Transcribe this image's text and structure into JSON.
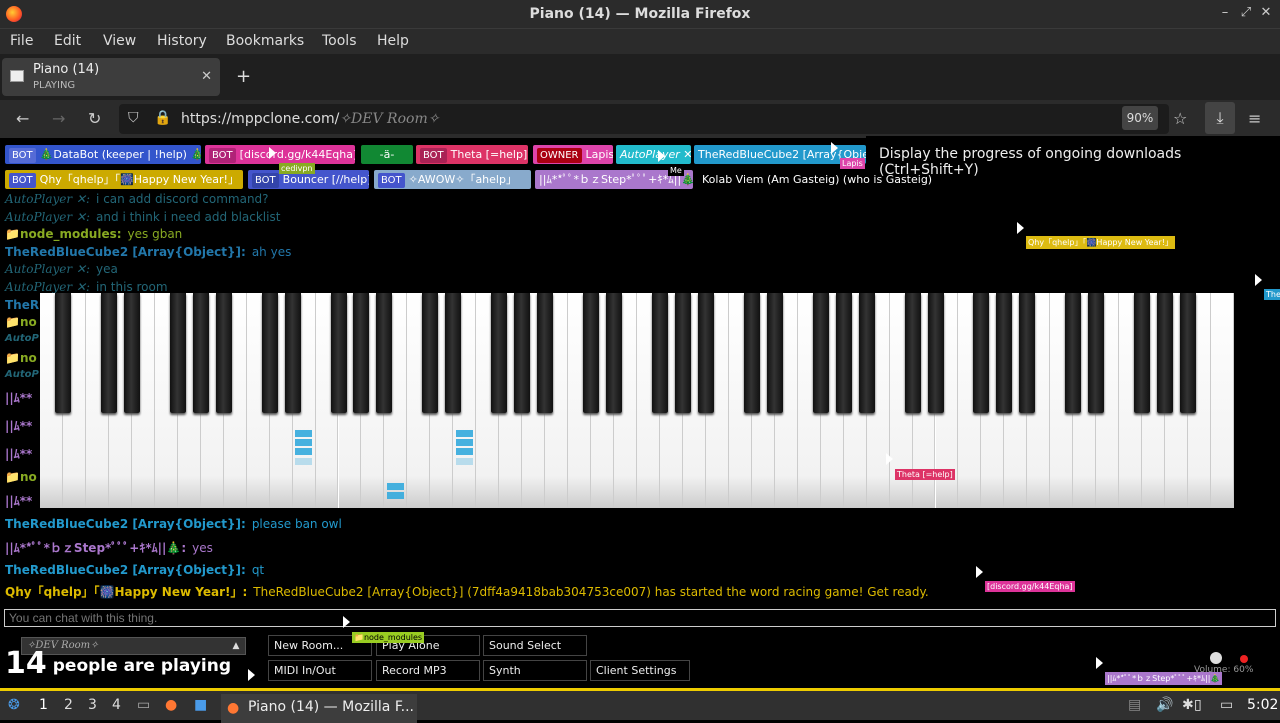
{
  "window": {
    "title": "Piano (14) — Mozilla Firefox",
    "minimize": "–",
    "maximize": "⤢",
    "close": "✕"
  },
  "menu": [
    "File",
    "Edit",
    "View",
    "History",
    "Bookmarks",
    "Tools",
    "Help"
  ],
  "tab": {
    "title": "Piano (14)",
    "status": "PLAYING",
    "close": "✕",
    "new_tab": "+"
  },
  "nav": {
    "back": "←",
    "forward": "→",
    "reload": "↻",
    "url_base": "https://mppclone.com/",
    "url_room": "✧DEV Room✧",
    "zoom": "90%",
    "star": "☆",
    "download": "⤓",
    "menu": "≡"
  },
  "tooltip": "Display the progress of ongoing downloads (Ctrl+Shift+Y)",
  "users_row1": [
    {
      "tag": "BOT",
      "name": "🎄DataBot (keeper | !help) 🎄",
      "bg": "#3355cc"
    },
    {
      "tag": "BOT",
      "name": "[discord.gg/k44Eqha]",
      "bg": "#dd3399"
    },
    {
      "tag": "",
      "name": "-ä-",
      "bg": "#118833"
    },
    {
      "tag": "BOT",
      "name": "Theta [=help]",
      "bg": "#dd3366"
    },
    {
      "tag": "OWNER",
      "name": "Lapis",
      "bg": "#dd44aa"
    },
    {
      "tag": "",
      "name": "AutoPlayer ✕",
      "bg": "#22bbcc"
    },
    {
      "tag": "",
      "name": "TheRedBlueCube2 [Array{Obje",
      "bg": "#2299cc"
    }
  ],
  "users_row2": [
    {
      "tag": "BOT",
      "name": "Qhy「qhelp」「🎆Happy New Year!」",
      "bg": "#ccaa00"
    },
    {
      "tag": "BOT",
      "name": "Bouncer [//help]",
      "bg": "#4455cc"
    },
    {
      "tag": "BOT",
      "name": "✧AWOW✧「ahelp」",
      "bg": "#88aacc"
    },
    {
      "tag": "",
      "name": "||ﾑ**ﾟﾟ*ｂｚStep*ﾟﾟﾟ+ｷ*ﾑ||🎄",
      "bg": "#aa77cc"
    },
    {
      "tag": "",
      "name": "Kolab Viem (Am Gasteig) (who is Gasteig)",
      "bg": "#000000"
    }
  ],
  "chat_top": [
    {
      "name": "AutoPlayer ✕:",
      "text": "i can add discord command?",
      "color": "#228899"
    },
    {
      "name": "AutoPlayer ✕:",
      "text": "and i think i need add blacklist",
      "color": "#228899"
    },
    {
      "name": "📁node_modules:",
      "text": "yes gban",
      "color": "#88aa22"
    },
    {
      "name": "TheRedBlueCube2 [Array{Object}]:",
      "text": "ah yes",
      "color": "#2277aa"
    },
    {
      "name": "AutoPlayer ✕:",
      "text": "yea",
      "color": "#228899"
    },
    {
      "name": "AutoPlayer ✕:",
      "text": "in this room",
      "color": "#228899"
    }
  ],
  "cut_names": [
    {
      "text": "TheR",
      "color": "#2277aa"
    },
    {
      "text": "📁no",
      "color": "#88aa22"
    },
    {
      "text": "AutoP",
      "color": "#228899"
    },
    {
      "text": "📁no",
      "color": "#88aa22"
    },
    {
      "text": "AutoP",
      "color": "#228899"
    },
    {
      "text": "||ﾑ**",
      "color": "#aa77cc"
    },
    {
      "text": "||ﾑ**",
      "color": "#aa77cc"
    },
    {
      "text": "||ﾑ**",
      "color": "#aa77cc"
    },
    {
      "text": "📁no",
      "color": "#88aa22"
    },
    {
      "text": "||ﾑ**",
      "color": "#aa77cc"
    }
  ],
  "chat_bottom": [
    {
      "name": "TheRedBlueCube2 [Array{Object}]:",
      "text": "please ban owl",
      "color": "#2299cc",
      "tcolor": "#2299cc"
    },
    {
      "name": "||ﾑ**ﾟﾟ*ｂｚStep*ﾟﾟﾟ+ｷ*ﾑ||🎄:",
      "text": "yes",
      "color": "#aa77cc",
      "tcolor": "#aa77cc"
    },
    {
      "name": "TheRedBlueCube2 [Array{Object}]:",
      "text": "qt",
      "color": "#2299cc",
      "tcolor": "#2299cc"
    },
    {
      "name": "Qhy「qhelp」「🎆Happy New Year!」:",
      "text": "TheRedBlueCube2 [Array{Object}] (7dff4a9418bab304753ce007) has started the word racing game! Get ready.",
      "color": "#ddbb00",
      "tcolor": "#ddbb00"
    }
  ],
  "chat_input_placeholder": "You can chat with this thing.",
  "room_select": "✧DEV Room✧",
  "room_arrow": "▲",
  "player_count": "14",
  "player_text": "people are playing",
  "controls": {
    "new_room": "New Room...",
    "play_alone": "Play Alone",
    "sound_select": "Sound Select",
    "midi": "MIDI In/Out",
    "record": "Record MP3",
    "synth": "Synth",
    "client_settings": "Client Settings"
  },
  "volume_label": "Volume: 60%",
  "cursor_labels": [
    {
      "text": "Qhy「qhelp」「🎆Happy New Year!」",
      "bg": "#ddbb11"
    },
    {
      "text": "Theta [=help]",
      "bg": "#dd3366"
    },
    {
      "text": "[discord.gg/k44Eqha]",
      "bg": "#dd3399"
    },
    {
      "text": "📁node_modules",
      "bg": "#99cc22"
    },
    {
      "text": "||ﾑ**ﾟﾟ*ｂｚStep*ﾟﾟﾟ+ｷ*ﾑ||🎄",
      "bg": "#aa77cc"
    },
    {
      "text": "cedivpn",
      "bg": "#88aa22"
    },
    {
      "text": "Me",
      "bg": "#000000"
    },
    {
      "text": "Lapis",
      "bg": "#dd44aa"
    },
    {
      "text": "The",
      "bg": "#2299cc"
    }
  ],
  "taskbar": {
    "workspaces": [
      "1",
      "2",
      "3",
      "4"
    ],
    "window": "Piano (14) — Mozilla F...",
    "clock": "5:02"
  },
  "colors": {
    "accent_taskbar": "#eecc00",
    "note_highlight": "#33aadd"
  }
}
